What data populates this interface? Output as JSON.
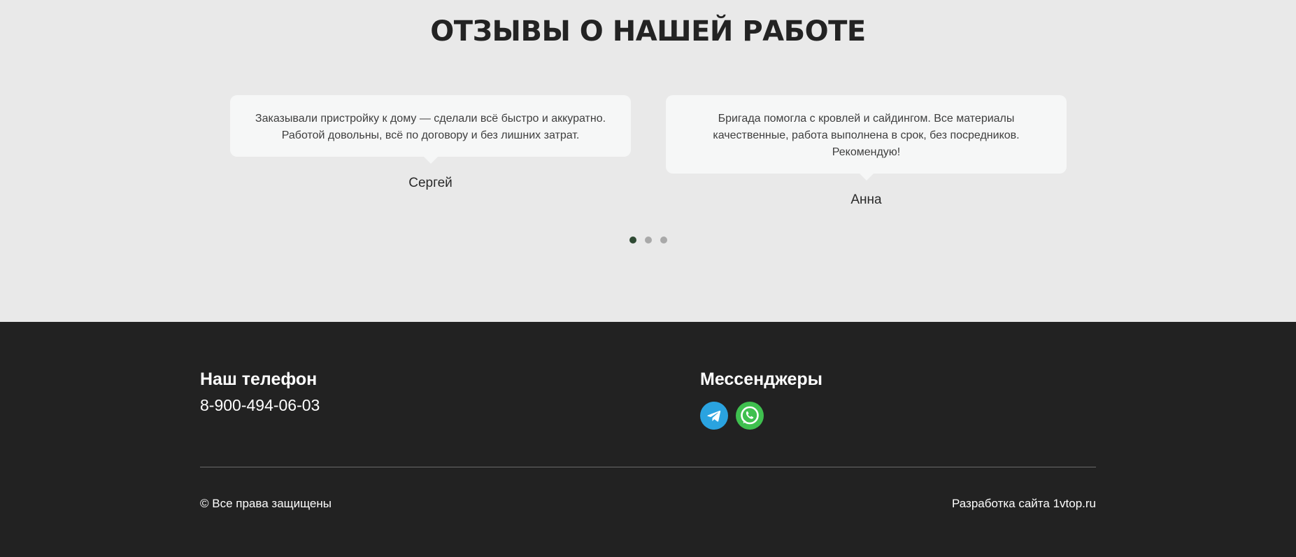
{
  "reviews": {
    "title": "ОТЗЫВЫ О НАШЕЙ РАБОТЕ",
    "items": [
      {
        "text": "Заказывали пристройку к дому — сделали всё быстро и аккуратно. Работой довольны, всё по договору и без лишних затрат.",
        "author": "Сергей"
      },
      {
        "text": "Бригада помогла с кровлей и сайдингом. Все материалы качественные, работа выполнена в срок, без посредников. Рекомендую!",
        "author": "Анна"
      }
    ],
    "pagination": {
      "total": 3,
      "active": 1
    }
  },
  "footer": {
    "phone_heading": "Наш телефон",
    "phone": "8-900-494-06-03",
    "messengers_heading": "Мессенджеры",
    "messengers": [
      {
        "icon": "telegram-icon",
        "color": "#2aa3e0"
      },
      {
        "icon": "whatsapp-icon",
        "color": "#3fc04f"
      }
    ],
    "copyright": "© Все права защищены",
    "developer": "Разработка сайта 1vtop.ru"
  }
}
